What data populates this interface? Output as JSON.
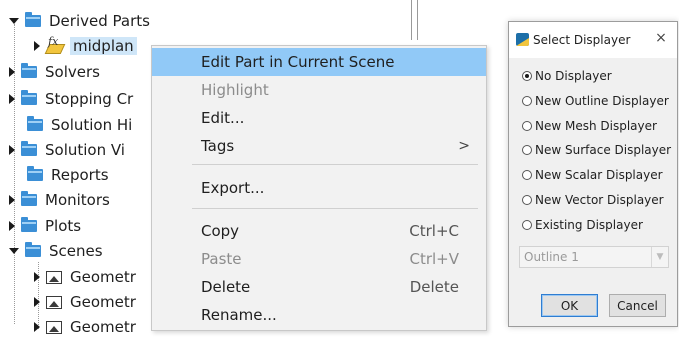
{
  "tree": {
    "items": [
      {
        "label": "Derived Parts",
        "icon": "folder-icon",
        "expander": "down"
      },
      {
        "label": "midplan",
        "icon": "fx-part-icon",
        "expander": "right"
      },
      {
        "label": "Solvers",
        "icon": "folder-icon",
        "expander": "right"
      },
      {
        "label": "Stopping Cr",
        "icon": "folder-icon",
        "expander": "right"
      },
      {
        "label": "Solution Hi",
        "icon": "folder-icon",
        "expander": "none"
      },
      {
        "label": "Solution Vi",
        "icon": "folder-icon",
        "expander": "right"
      },
      {
        "label": "Reports",
        "icon": "folder-icon",
        "expander": "none"
      },
      {
        "label": "Monitors",
        "icon": "folder-icon",
        "expander": "right"
      },
      {
        "label": "Plots",
        "icon": "folder-icon",
        "expander": "right"
      },
      {
        "label": "Scenes",
        "icon": "folder-icon",
        "expander": "down"
      },
      {
        "label": "Geometr",
        "icon": "scene-icon",
        "expander": "right"
      },
      {
        "label": "Geometr",
        "icon": "scene-icon",
        "expander": "right"
      },
      {
        "label": "Geometr",
        "icon": "scene-icon",
        "expander": "right"
      }
    ]
  },
  "context_menu": {
    "items": [
      {
        "label": "Edit Part in Current Scene",
        "shortcut": "",
        "highlighted": true,
        "disabled": false
      },
      {
        "label": "Highlight",
        "shortcut": "",
        "highlighted": false,
        "disabled": true
      },
      {
        "label": "Edit...",
        "shortcut": "",
        "highlighted": false,
        "disabled": false
      },
      {
        "label": "Tags",
        "shortcut": "",
        "submenu_glyph": ">",
        "highlighted": false,
        "disabled": false
      },
      {
        "label": "Export...",
        "shortcut": "",
        "highlighted": false,
        "disabled": false
      },
      {
        "label": "Copy",
        "shortcut": "Ctrl+C",
        "highlighted": false,
        "disabled": false
      },
      {
        "label": "Paste",
        "shortcut": "Ctrl+V",
        "highlighted": false,
        "disabled": true
      },
      {
        "label": "Delete",
        "shortcut": "Delete",
        "highlighted": false,
        "disabled": false
      },
      {
        "label": "Rename...",
        "shortcut": "",
        "highlighted": false,
        "disabled": false
      }
    ]
  },
  "dialog": {
    "title": "Select Displayer",
    "close_glyph": "×",
    "options": [
      {
        "label": "No Displayer",
        "selected": true
      },
      {
        "label": "New Outline Displayer",
        "selected": false
      },
      {
        "label": "New Mesh Displayer",
        "selected": false
      },
      {
        "label": "New Surface Displayer",
        "selected": false
      },
      {
        "label": "New Scalar Displayer",
        "selected": false
      },
      {
        "label": "New Vector Displayer",
        "selected": false
      },
      {
        "label": "Existing Displayer",
        "selected": false
      }
    ],
    "existing_select": {
      "value": "Outline 1",
      "disabled": true
    },
    "ok_label": "OK",
    "cancel_label": "Cancel"
  },
  "colors": {
    "menu_highlight": "#91c9f7",
    "folder": "#3b8fd6",
    "selection": "#cfe6f8"
  }
}
